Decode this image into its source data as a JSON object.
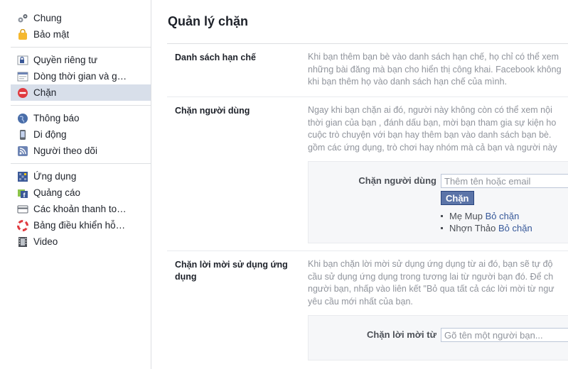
{
  "sidebar": {
    "groups": [
      [
        {
          "label": "Chung",
          "icon": "gears-icon"
        },
        {
          "label": "Bảo mật",
          "icon": "lock-badge-icon"
        }
      ],
      [
        {
          "label": "Quyền riêng tư",
          "icon": "privacy-lock-icon"
        },
        {
          "label": "Dòng thời gian và g…",
          "icon": "timeline-icon"
        },
        {
          "label": "Chặn",
          "icon": "block-icon",
          "active": true
        }
      ],
      [
        {
          "label": "Thông báo",
          "icon": "globe-icon"
        },
        {
          "label": "Di động",
          "icon": "mobile-icon"
        },
        {
          "label": "Người theo dõi",
          "icon": "rss-icon"
        }
      ],
      [
        {
          "label": "Ứng dụng",
          "icon": "apps-icon"
        },
        {
          "label": "Quảng cáo",
          "icon": "ads-icon"
        },
        {
          "label": "Các khoản thanh to…",
          "icon": "credit-card-icon"
        },
        {
          "label": "Bảng điều khiển hỗ…",
          "icon": "lifebuoy-icon"
        },
        {
          "label": "Video",
          "icon": "film-icon"
        }
      ]
    ]
  },
  "main": {
    "title": "Quản lý chặn",
    "restricted": {
      "label": "Danh sách hạn chế",
      "desc": [
        "Khi bạn thêm bạn bè vào danh sách hạn chế, họ chỉ có thể xem",
        "những bài đăng mà bạn cho hiển thị công khai. Facebook không",
        "khi bạn thêm họ vào danh sách hạn chế của mình."
      ]
    },
    "block_users": {
      "label": "Chặn người dùng",
      "desc": [
        "Ngay khi bạn chặn ai đó, người này không còn có thể xem nội",
        "thời gian của bạn , đánh dấu bạn, mời bạn tham gia sự kiện ho",
        "cuộc trò chuyện với bạn hay thêm bạn vào danh sách bạn bè.",
        "gồm các ứng dụng, trò chơi hay nhóm mà cả bạn và người này"
      ],
      "field_label": "Chặn người dùng",
      "placeholder": "Thêm tên hoặc email",
      "button": "Chặn",
      "blocked": [
        {
          "name": "Mẹ Mup",
          "action": "Bỏ chặn"
        },
        {
          "name": "Nhợn Thảo",
          "action": "Bỏ chặn"
        }
      ]
    },
    "block_app_invites": {
      "label": "Chặn lời mời sử dụng ứng dụng",
      "desc": [
        "Khi bạn chặn lời mời sử dụng ứng dụng từ ai đó, bạn sẽ tự độ",
        "cầu sử dụng ứng dụng trong tương lai từ người bạn đó. Để ch",
        "người bạn, nhấp vào liên kết \"Bỏ qua tất cả các lời mời từ ngư",
        "yêu cầu mới nhất của bạn."
      ],
      "field_label": "Chặn lời mời từ",
      "placeholder": "Gõ tên một người bạn..."
    }
  }
}
